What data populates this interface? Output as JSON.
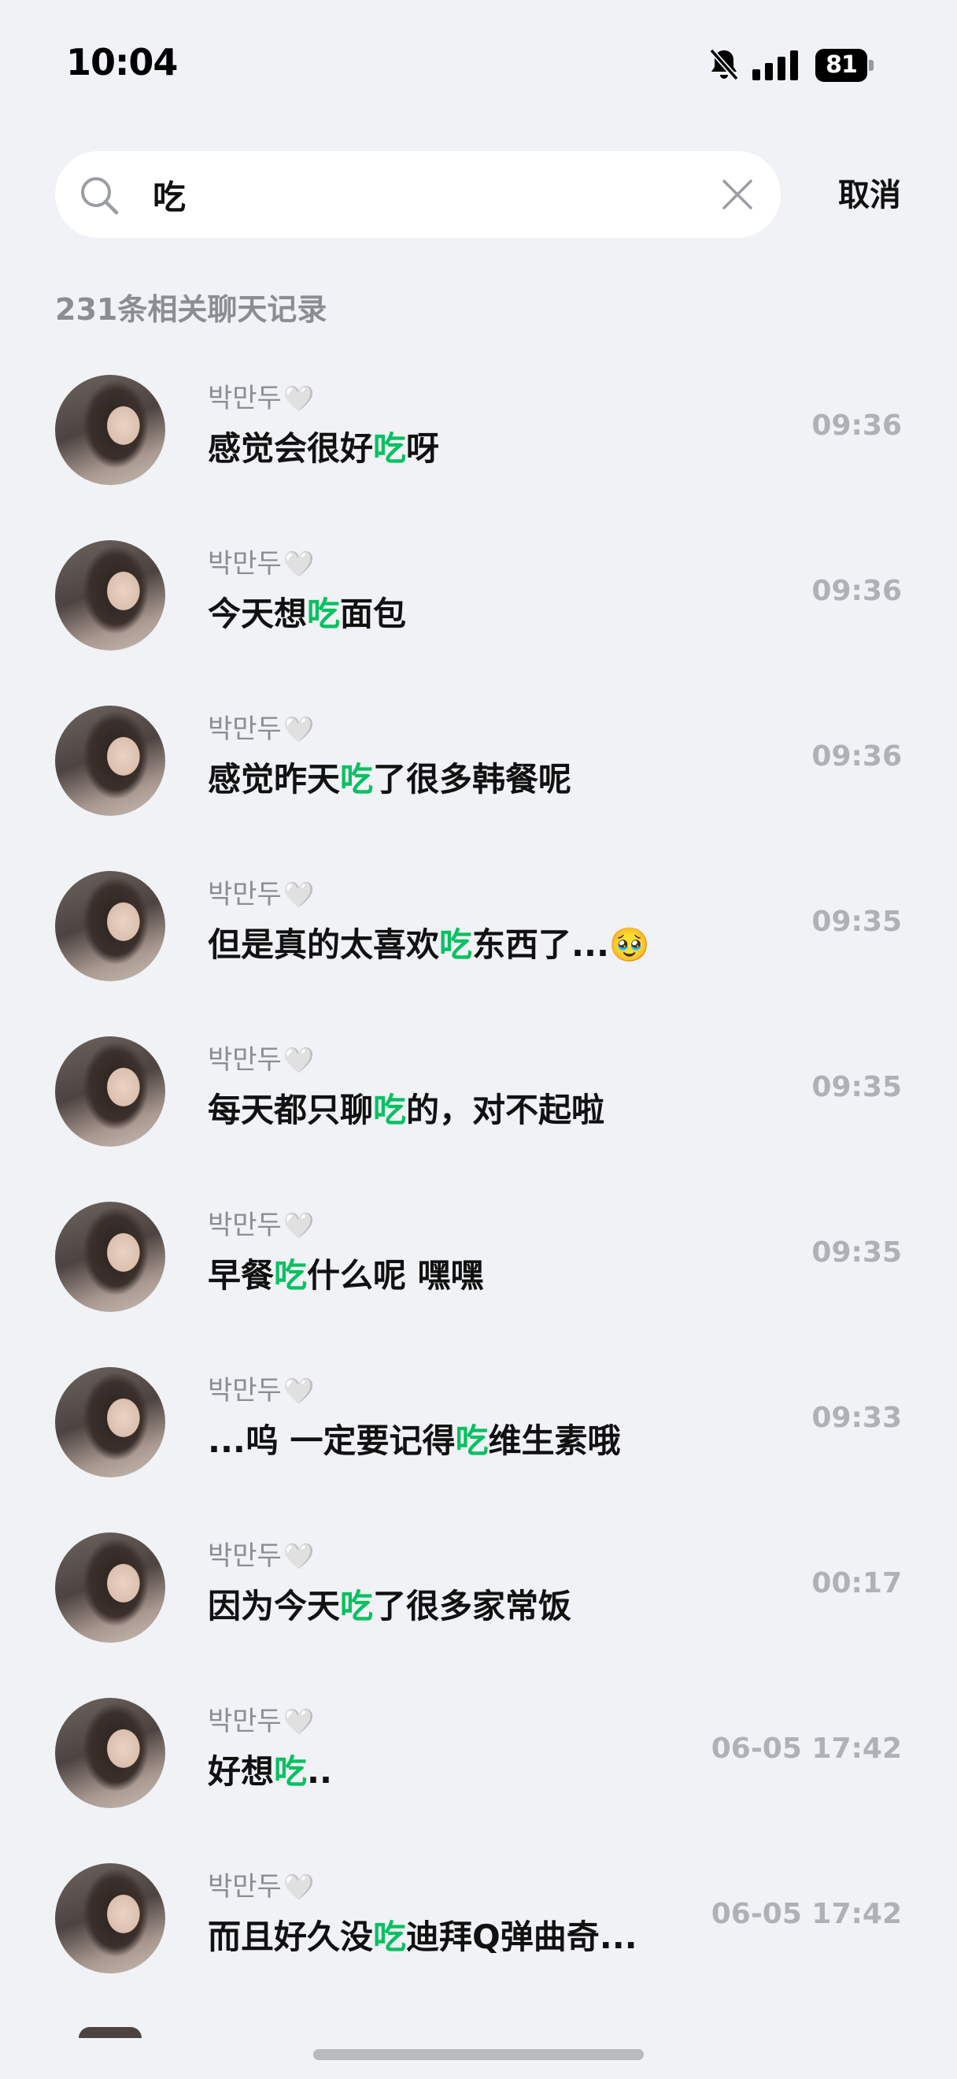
{
  "status_bar": {
    "time": "10:04",
    "battery": "81",
    "icons": [
      "bell-slash-icon",
      "signal-icon",
      "battery-icon"
    ]
  },
  "search": {
    "query": "吃",
    "placeholder": "",
    "cancel_label": "取消"
  },
  "results_header": {
    "count_text": "231条相关聊天记录"
  },
  "colors": {
    "highlight": "#07c160",
    "background": "#f0f2f5",
    "secondary_text": "#8a8d93"
  },
  "results": [
    {
      "sender": "박만두",
      "heart": "🤍",
      "before": "感觉会很好",
      "keyword": "吃",
      "after": "呀",
      "time": "09:36"
    },
    {
      "sender": "박만두",
      "heart": "🤍",
      "before": "今天想",
      "keyword": "吃",
      "after": "面包",
      "time": "09:36"
    },
    {
      "sender": "박만두",
      "heart": "🤍",
      "before": "感觉昨天",
      "keyword": "吃",
      "after": "了很多韩餐呢",
      "time": "09:36"
    },
    {
      "sender": "박만두",
      "heart": "🤍",
      "before": "但是真的太喜欢",
      "keyword": "吃",
      "after": "东西了...🥹",
      "time": "09:35"
    },
    {
      "sender": "박만두",
      "heart": "🤍",
      "before": "每天都只聊",
      "keyword": "吃",
      "after": "的，对不起啦",
      "time": "09:35"
    },
    {
      "sender": "박만두",
      "heart": "🤍",
      "before": "早餐",
      "keyword": "吃",
      "after": "什么呢 嘿嘿",
      "time": "09:35"
    },
    {
      "sender": "박만두",
      "heart": "🤍",
      "before": "...呜 一定要记得",
      "keyword": "吃",
      "after": "维生素哦",
      "time": "09:33"
    },
    {
      "sender": "박만두",
      "heart": "🤍",
      "before": "因为今天",
      "keyword": "吃",
      "after": "了很多家常饭",
      "time": "00:17"
    },
    {
      "sender": "박만두",
      "heart": "🤍",
      "before": "好想",
      "keyword": "吃",
      "after": "..",
      "time": "06-05 17:42"
    },
    {
      "sender": "박만두",
      "heart": "🤍",
      "before": "而且好久没",
      "keyword": "吃",
      "after": "迪拜Q弹曲奇...",
      "time": "06-05 17:42"
    }
  ]
}
